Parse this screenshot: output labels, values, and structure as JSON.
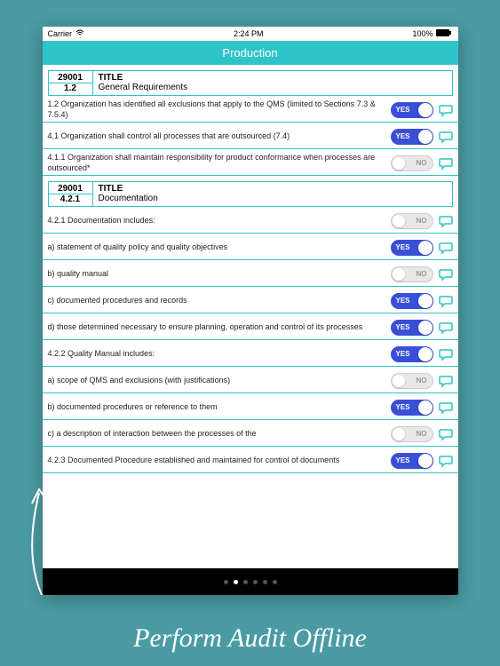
{
  "status": {
    "carrier": "Carrier",
    "time": "2:24 PM",
    "battery": "100%"
  },
  "header": {
    "title": "Production"
  },
  "sections": [
    {
      "code1": "29001",
      "code2": "1.2",
      "title_label": "TITLE",
      "title_value": "General Requirements",
      "rows": [
        {
          "text": "1.2 Organization has identified all exclusions that apply to the QMS (limited to Sections 7.3 & 7.5.4)",
          "state": "YES"
        },
        {
          "text": "4.1 Organization shall control all processes that are outsourced (7.4)",
          "state": "YES"
        },
        {
          "text": "4.1.1 Organization shall maintain responsibility for product conformance when processes are outsourced*",
          "state": "NO"
        }
      ]
    },
    {
      "code1": "29001",
      "code2": "4.2.1",
      "title_label": "TITLE",
      "title_value": "Documentation",
      "rows": [
        {
          "text": "4.2.1 Documentation includes:",
          "state": "NO"
        },
        {
          "text": "a) statement of quality policy and quality objectives",
          "state": "YES"
        },
        {
          "text": "b) quality manual",
          "state": "NO"
        },
        {
          "text": "c) documented procedures and records",
          "state": "YES"
        },
        {
          "text": "d) those determined necessary to ensure planning, operation and control of its processes",
          "state": "YES"
        },
        {
          "text": "4.2.2 Quality Manual includes:",
          "state": "YES"
        },
        {
          "text": "a) scope of QMS and exclusions (with justifications)",
          "state": "NO"
        },
        {
          "text": "b) documented procedures or reference to them",
          "state": "YES"
        },
        {
          "text": "c) a description of interaction between the processes of the",
          "state": "NO"
        },
        {
          "text": "4.2.3 Documented Procedure established and maintained for control of documents",
          "state": "YES"
        }
      ]
    }
  ],
  "toggle_labels": {
    "yes": "YES",
    "no": "NO"
  },
  "page_dots": {
    "count": 6,
    "active": 1
  },
  "caption": "Perform Audit Offline"
}
